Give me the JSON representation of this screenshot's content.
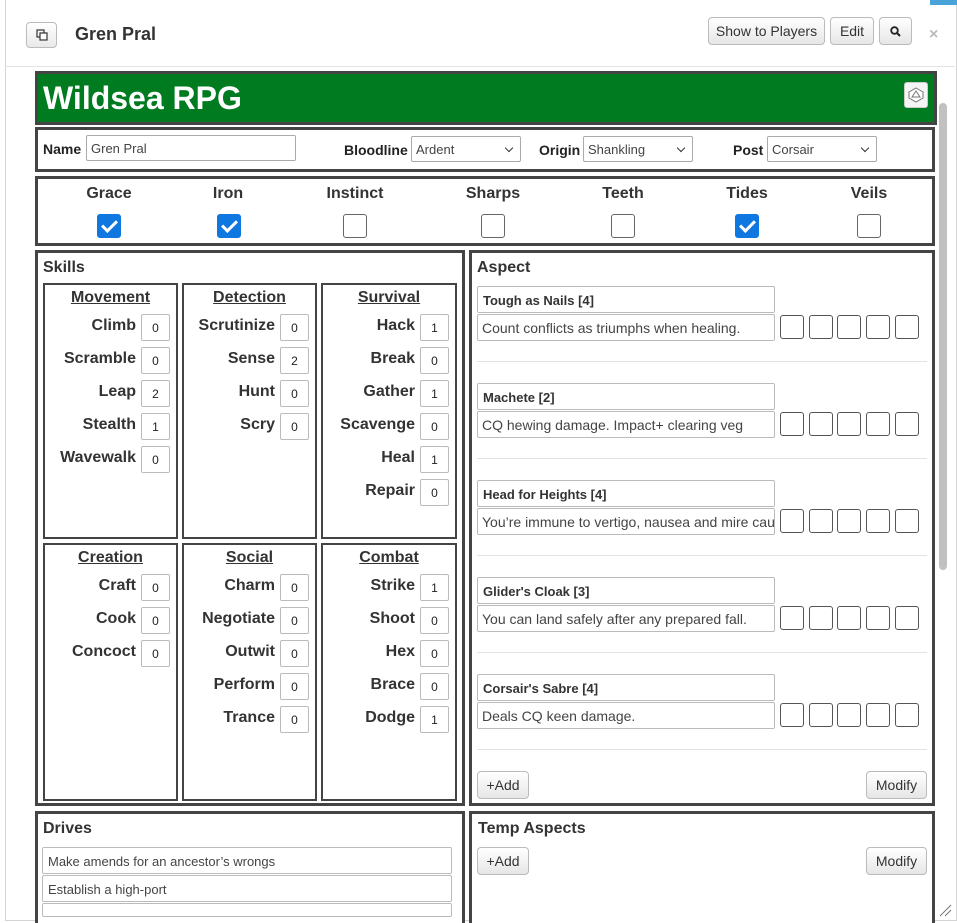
{
  "window": {
    "title": "Gren Pral",
    "show_players": "Show to Players",
    "edit": "Edit",
    "close": "×"
  },
  "sheet": {
    "banner": "Wildsea RPG",
    "name_label": "Name",
    "name_value": "Gren Pral",
    "bloodline_label": "Bloodline",
    "bloodline_value": "Ardent",
    "origin_label": "Origin",
    "origin_value": "Shankling",
    "post_label": "Post",
    "post_value": "Corsair"
  },
  "attributes": [
    {
      "name": "Grace",
      "checked": true
    },
    {
      "name": "Iron",
      "checked": true
    },
    {
      "name": "Instinct",
      "checked": false
    },
    {
      "name": "Sharps",
      "checked": false
    },
    {
      "name": "Teeth",
      "checked": false
    },
    {
      "name": "Tides",
      "checked": true
    },
    {
      "name": "Veils",
      "checked": false
    }
  ],
  "skills": {
    "title": "Skills",
    "groups": [
      {
        "title": "Movement",
        "items": [
          [
            "Climb",
            "0"
          ],
          [
            "Scramble",
            "0"
          ],
          [
            "Leap",
            "2"
          ],
          [
            "Stealth",
            "1"
          ],
          [
            "Wavewalk",
            "0"
          ]
        ]
      },
      {
        "title": "Detection",
        "items": [
          [
            "Scrutinize",
            "0"
          ],
          [
            "Sense",
            "2"
          ],
          [
            "Hunt",
            "0"
          ],
          [
            "Scry",
            "0"
          ]
        ]
      },
      {
        "title": "Survival",
        "items": [
          [
            "Hack",
            "1"
          ],
          [
            "Break",
            "0"
          ],
          [
            "Gather",
            "1"
          ],
          [
            "Scavenge",
            "0"
          ],
          [
            "Heal",
            "1"
          ],
          [
            "Repair",
            "0"
          ]
        ]
      },
      {
        "title": "Creation",
        "items": [
          [
            "Craft",
            "0"
          ],
          [
            "Cook",
            "0"
          ],
          [
            "Concoct",
            "0"
          ]
        ]
      },
      {
        "title": "Social",
        "items": [
          [
            "Charm",
            "0"
          ],
          [
            "Negotiate",
            "0"
          ],
          [
            "Outwit",
            "0"
          ],
          [
            "Perform",
            "0"
          ],
          [
            "Trance",
            "0"
          ]
        ]
      },
      {
        "title": "Combat",
        "items": [
          [
            "Strike",
            "1"
          ],
          [
            "Shoot",
            "0"
          ],
          [
            "Hex",
            "0"
          ],
          [
            "Brace",
            "0"
          ],
          [
            "Dodge",
            "1"
          ]
        ]
      }
    ]
  },
  "aspect": {
    "title": "Aspect",
    "items": [
      {
        "name": "Tough as Nails [4]",
        "desc": "Count conflicts as triumphs when healing."
      },
      {
        "name": "Machete [2]",
        "desc": "CQ hewing damage. Impact+ clearing veg"
      },
      {
        "name": "Head for Heights [4]",
        "desc": "You’re immune to vertigo, nausea and mire cau"
      },
      {
        "name": "Glider's Cloak [3]",
        "desc": "You can land safely after any prepared fall."
      },
      {
        "name": "Corsair's Sabre [4]",
        "desc": "Deals CQ keen damage."
      }
    ],
    "add": "+Add",
    "modify": "Modify"
  },
  "drives": {
    "title": "Drives",
    "items": [
      "Make amends for an ancestor’s wrongs",
      "Establish a high-port"
    ]
  },
  "temp_aspects": {
    "title": "Temp Aspects",
    "add": "+Add",
    "modify": "Modify"
  }
}
